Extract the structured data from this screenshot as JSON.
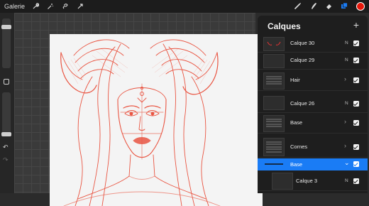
{
  "toolbar": {
    "gallery": "Galerie",
    "left_icons": [
      "wrench-icon",
      "magic-wand-icon",
      "selection-icon",
      "transform-icon"
    ],
    "right_icons": [
      "brush-icon",
      "smudge-icon",
      "eraser-icon",
      "layers-icon"
    ],
    "color": "#e8170a"
  },
  "panel": {
    "title": "Calques",
    "add": "+",
    "layers": [
      {
        "name": "Calque 30",
        "blend": "N",
        "visible": true
      },
      {
        "name": "Calque 29",
        "blend": "N",
        "visible": true
      },
      {
        "name": "Hair",
        "blend": "",
        "visible": true,
        "group": true
      },
      {
        "name": "Calque 26",
        "blend": "N",
        "visible": true
      },
      {
        "name": "Base",
        "blend": "",
        "visible": true,
        "group": true
      },
      {
        "name": "Cornes",
        "blend": "",
        "visible": true,
        "group": true
      },
      {
        "name": "Base",
        "blend": "",
        "visible": true,
        "group": true,
        "selected": true
      },
      {
        "name": "Calque 3",
        "blend": "N",
        "visible": true
      }
    ]
  },
  "colors": {
    "accent": "#1a7cf5",
    "sketch": "#e8442f"
  }
}
